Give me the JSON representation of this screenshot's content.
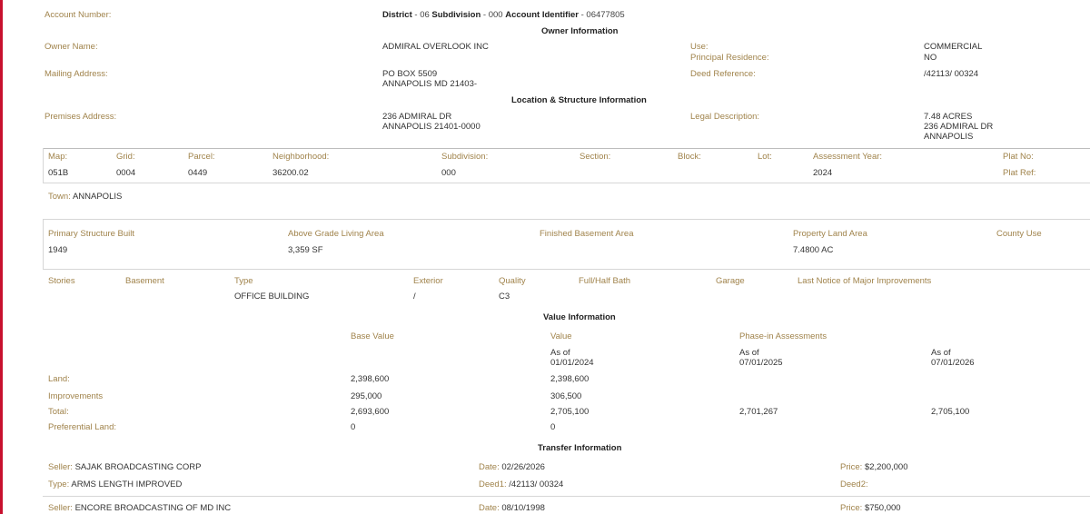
{
  "colors": {
    "label": "#a0834b",
    "value": "#333333",
    "edge": "#c8102e",
    "divider": "#d6d6d6"
  },
  "account": {
    "label": "Account Number:",
    "district_label": "District",
    "district": "06",
    "subdivision_label": "Subdivision",
    "subdivision": "000",
    "identifier_label": "Account Identifier",
    "identifier": "06477805",
    "sep": "-"
  },
  "owner": {
    "header": "Owner Information",
    "name_label": "Owner Name:",
    "name": "ADMIRAL OVERLOOK INC",
    "mailing_label": "Mailing Address:",
    "mailing_line1": "PO BOX 5509",
    "mailing_line2": "ANNAPOLIS MD 21403-",
    "use_label": "Use:",
    "use": "COMMERCIAL",
    "principal_label": "Principal Residence:",
    "principal": "NO",
    "deed_label": "Deed Reference:",
    "deed": "/42113/ 00324"
  },
  "location": {
    "header": "Location & Structure Information",
    "premises_label": "Premises Address:",
    "premises_line1": "236 ADMIRAL DR",
    "premises_line2": "ANNAPOLIS 21401-0000",
    "legal_label": "Legal Description:",
    "legal_line1": "7.48 ACRES",
    "legal_line2": "236 ADMIRAL DR",
    "legal_line3": "ANNAPOLIS"
  },
  "parcel": {
    "map_label": "Map:",
    "map": "051B",
    "grid_label": "Grid:",
    "grid": "0004",
    "parcel_label": "Parcel:",
    "parcel": "0449",
    "neighborhood_label": "Neighborhood:",
    "neighborhood": "36200.02",
    "subdivision_label": "Subdivision:",
    "subdivision": "000",
    "section_label": "Section:",
    "block_label": "Block:",
    "lot_label": "Lot:",
    "assessment_year_label": "Assessment Year:",
    "assessment_year": "2024",
    "plat_no_label": "Plat No:",
    "plat_ref_label": "Plat Ref:",
    "town_label": "Town:",
    "town": "ANNAPOLIS"
  },
  "structure": {
    "built_label": "Primary Structure Built",
    "built": "1949",
    "living_label": "Above Grade Living Area",
    "living": "3,359 SF",
    "basement_area_label": "Finished Basement Area",
    "land_area_label": "Property Land Area",
    "land_area": "7.4800 AC",
    "county_use_label": "County Use"
  },
  "building": {
    "stories_label": "Stories",
    "basement_label": "Basement",
    "type_label": "Type",
    "type": "OFFICE BUILDING",
    "exterior_label": "Exterior",
    "exterior": "/",
    "quality_label": "Quality",
    "quality": "C3",
    "bath_label": "Full/Half Bath",
    "garage_label": "Garage",
    "improvements_label": "Last Notice of Major Improvements"
  },
  "value": {
    "header": "Value Information",
    "base_label": "Base Value",
    "value_label": "Value",
    "phase_label": "Phase-in Assessments",
    "asof": "As of",
    "date1": "01/01/2024",
    "date2": "07/01/2025",
    "date3": "07/01/2026",
    "land_label": "Land:",
    "land_base": "2,398,600",
    "land_value": "2,398,600",
    "impr_label": "Improvements",
    "impr_base": "295,000",
    "impr_value": "306,500",
    "total_label": "Total:",
    "total_base": "2,693,600",
    "total_value": "2,705,100",
    "total_phase1": "2,701,267",
    "total_phase2": "2,705,100",
    "pref_label": "Preferential Land:",
    "pref_base": "0",
    "pref_value": "0"
  },
  "transfer": {
    "header": "Transfer Information",
    "seller_label": "Seller:",
    "type_label": "Type:",
    "date_label": "Date:",
    "deed1_label": "Deed1:",
    "price_label": "Price:",
    "deed2_label": "Deed2:",
    "t1": {
      "seller": "SAJAK BROADCASTING CORP",
      "type": "ARMS LENGTH IMPROVED",
      "date": "02/26/2026",
      "deed1": "/42113/ 00324",
      "price": "$2,200,000"
    },
    "t2": {
      "seller": "ENCORE BROADCASTING OF MD INC",
      "date": "08/10/1998",
      "price": "$750,000"
    }
  }
}
